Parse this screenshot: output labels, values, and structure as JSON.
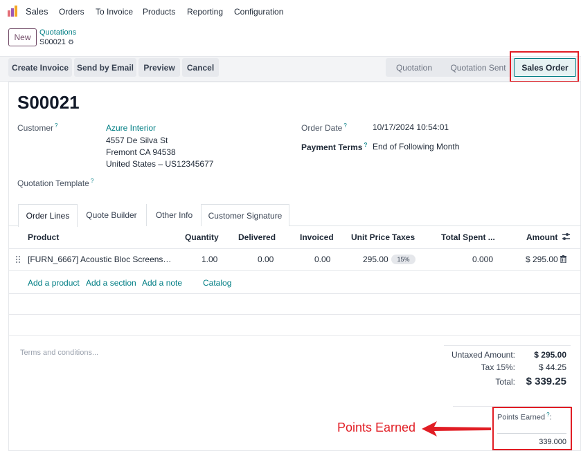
{
  "app": {
    "name": "Sales",
    "menu": [
      "Orders",
      "To Invoice",
      "Products",
      "Reporting",
      "Configuration"
    ]
  },
  "control": {
    "new_label": "New",
    "breadcrumb_parent": "Quotations",
    "breadcrumb_current": "S00021"
  },
  "actions": {
    "create_invoice": "Create Invoice",
    "send_email": "Send by Email",
    "preview": "Preview",
    "cancel": "Cancel"
  },
  "status": {
    "steps": [
      "Quotation",
      "Quotation Sent",
      "Sales Order"
    ],
    "active": "Sales Order"
  },
  "record": {
    "name": "S00021",
    "customer_label": "Customer",
    "customer_name": "Azure Interior",
    "address_line1": "4557 De Silva St",
    "address_line2": "Fremont CA 94538",
    "address_line3": "United States – US12345677",
    "order_date_label": "Order Date",
    "order_date": "10/17/2024 10:54:01",
    "payment_terms_label": "Payment Terms",
    "payment_terms": "End of Following Month",
    "quotation_template_label": "Quotation Template"
  },
  "tabs": [
    "Order Lines",
    "Quote Builder",
    "Other Info",
    "Customer Signature"
  ],
  "table": {
    "headers": {
      "product": "Product",
      "quantity": "Quantity",
      "delivered": "Delivered",
      "invoiced": "Invoiced",
      "unit_price": "Unit Price",
      "taxes": "Taxes",
      "total_spent": "Total Spent ...",
      "amount": "Amount"
    },
    "rows": [
      {
        "product": "[FURN_6667] Acoustic Bloc Screens…",
        "quantity": "1.00",
        "delivered": "0.00",
        "invoiced": "0.00",
        "unit_price": "295.00",
        "tax": "15%",
        "total_spent": "0.000",
        "amount": "$ 295.00"
      }
    ],
    "add_product": "Add a product",
    "add_section": "Add a section",
    "add_note": "Add a note",
    "catalog": "Catalog"
  },
  "footer": {
    "terms_placeholder": "Terms and conditions...",
    "untaxed_label": "Untaxed Amount:",
    "untaxed_value": "$ 295.00",
    "tax_label": "Tax 15%:",
    "tax_value": "$ 44.25",
    "total_label": "Total:",
    "total_value": "$ 339.25",
    "points_label": "Points Earned",
    "points_suffix": ":",
    "points_value": "339.000"
  },
  "annotation": {
    "text": "Points Earned",
    "color": "#e11d24"
  },
  "colors": {
    "accent": "#714b67",
    "link": "#017e84"
  }
}
